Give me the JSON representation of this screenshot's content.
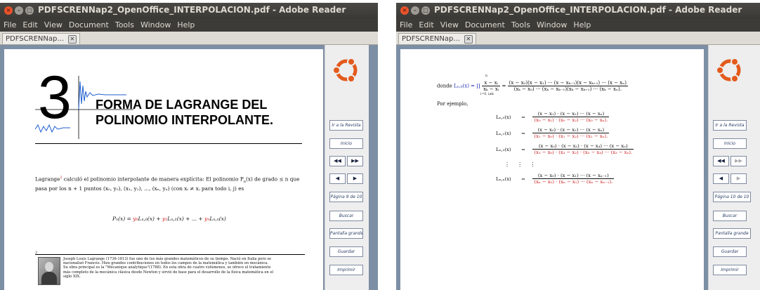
{
  "left": {
    "title": "PDFSCRENNap2_OpenOffice_INTERPOLACION.pdf - Adobe Reader",
    "menu": [
      "File",
      "Edit",
      "View",
      "Document",
      "Tools",
      "Window",
      "Help"
    ],
    "tab": "PDFSCRENNap...",
    "chapter_number": "3",
    "chapter_title_1": "FORMA DE LAGRANGE DEL",
    "chapter_title_2": "POLINOMIO INTERPOLANTE.",
    "para_lead": "Lagrange",
    "footnote_mark": "2",
    "para_rest_1": " calculó el polinomio interpolante de manera explícita: El polinomio P",
    "para_sub_n": "n",
    "para_rest_2": "(x)  de grado ≤ n  que",
    "para_line2": "pasa por los n + 1 puntos (x₀, y₀), (x₁, y₁), ..., (xₙ, yₙ) (con xᵢ ≠ xⱼ para todo i, j) es",
    "formula_lhs": "Pₙ(x) = ",
    "formula_y0": "y₀",
    "formula_t0": "Lₙ,₀(x) + ",
    "formula_y1": "y₁",
    "formula_t1": "Lₙ,₁(x) + ... + ",
    "formula_yn": "yₙ",
    "formula_tn": "Lₙ,ₙ(x)",
    "footnote_num": "2",
    "footnote_text": "Joseph Louis Lagrange (1736-1813) fue uno de los más grandes matemáticos de su tiempo. Nació en Italia pero se nacionalizó Francés. Hizo grandes contribuciones en todos los campos de la matemática y también en mecánica. Su obra principal es la \"Mécanique analytique\"(1788). En esta obra de cuatro volúmenes, se ofrece el tratamiento más completo de la mecánica clásica desde Newton y sirvió de base para el desarrollo de la física matemática en el siglo XIX.",
    "nav": {
      "revista": "Ir a la Revista",
      "inicio": "Inicio",
      "pagina": "Página 9 de 10",
      "buscar": "Buscar",
      "pantalla": "Pantalla grande",
      "guardar": "Guardar",
      "imprimir": "Imprimir",
      "first": "◀◀",
      "last": "▶▶",
      "prev": "◀",
      "next": "▶"
    }
  },
  "right": {
    "title": "PDFSCRENNap2_OpenOffice_INTERPOLACION.pdf - Adobe Reader",
    "menu": [
      "File",
      "Edit",
      "View",
      "Document",
      "Tools",
      "Window",
      "Help"
    ],
    "tab": "PDFSCRENNap...",
    "donde": "donde",
    "def_lhs": "Lₙ,ₖ(x) = ∏",
    "def_prod_top": "n",
    "def_prod_bot": "i=0, i≠k",
    "def_frac_num": "x − xᵢ",
    "def_frac_den": "xₖ − xᵢ",
    "def_eq": "=",
    "def_big_num": "(x − x₀)(x − x₁) ··· (x − xₖ₋₁)(x − xₖ₊₁) ··· (x − xₙ)",
    "def_big_den": "(xₖ − x₀) ··· (xₖ − xₖ₋₁)(xₖ − xₖ₊₁) ··· (xₖ − xₙ).",
    "por_ejemplo": "Por ejemplo,",
    "rows": [
      {
        "lhs": "Lₙ,₀(x)",
        "eq": "=",
        "num": "(x − x₁) · (x − x₂) ··· (x − xₙ)",
        "den": "(x₀ − x₁) · (x₀ − x₂) ··· (x₀ − xₙ)."
      },
      {
        "lhs": "Lₙ,₁(x)",
        "eq": "=",
        "num": "(x − x₀) · (x − x₂) ··· (x − xₙ)",
        "den": "(x₁ − x₀) · (x₁ − x₂) ··· (x₁ − xₙ)."
      },
      {
        "lhs": "Lₙ,₃(x)",
        "eq": "=",
        "num": "(x − x₀) · (x − x₂) · (x − x₄) ··· (x − xₙ)",
        "den": "(x₃ − x₀) · (x₃ − x₂) · (x₃ − x₄) ··· (x₃ − xₙ)."
      },
      {
        "lhs": "Lₙ,ₙ(x)",
        "eq": "=",
        "num": "(x − x₀) · (x − x₁) ··· (x − xₙ₋₁)",
        "den": "(xₙ − x₀) · (xₙ − x₁) ··· (xₙ − xₙ₋₁)."
      }
    ],
    "vdots": "⋮    ⋮    ⋮",
    "nav": {
      "revista": "Ir a la Revista",
      "inicio": "Inicio",
      "pagina": "Página 10 de 10",
      "buscar": "Buscar",
      "pantalla": "Pantalla grande",
      "guardar": "Guardar",
      "imprimir": "Imprimir",
      "first": "◀◀",
      "last": "▶▶",
      "prev": "◀",
      "next": "▶"
    }
  },
  "colors": {
    "titlebar": "#3c3b37",
    "menu_text": "#dfdbd2",
    "viewer_bg": "#7d8fa5",
    "close_button": "#e9532b",
    "math_red": "#d01a1a",
    "math_blue": "#1a2ba8",
    "plot_blue": "#1f5fd0"
  }
}
